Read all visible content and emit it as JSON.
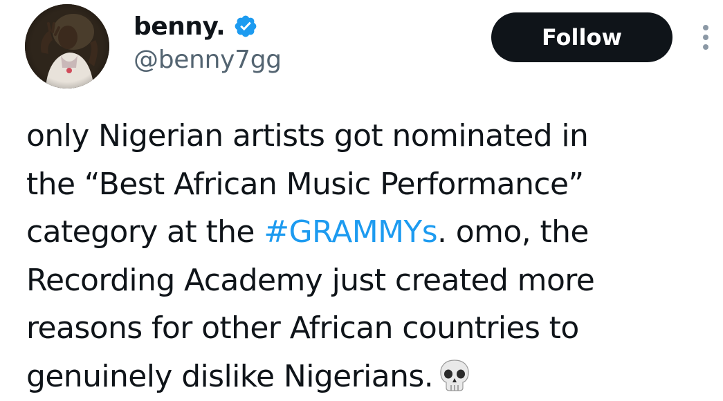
{
  "author": {
    "display_name": "benny.",
    "handle": "@benny7gg",
    "verified_icon": "verified-badge-icon",
    "avatar": "profile-photo"
  },
  "actions": {
    "follow_label": "Follow",
    "more_icon": "more-options-icon"
  },
  "tweet": {
    "lines": [
      "only Nigerian artists got nominated in",
      "the “Best African Music Performance”",
      "category at the ",
      ". omo, the",
      "Recording Academy just created more",
      "reasons for other African countries to",
      "genuinely dislike Nigerians."
    ],
    "hashtag": "#GRAMMYs",
    "emoji": "skull-emoji-icon"
  },
  "colors": {
    "text": "#0f1419",
    "secondary_text": "#536471",
    "link": "#1d9bf0",
    "verified": "#1d9bf0",
    "button_bg": "#0f1419"
  }
}
